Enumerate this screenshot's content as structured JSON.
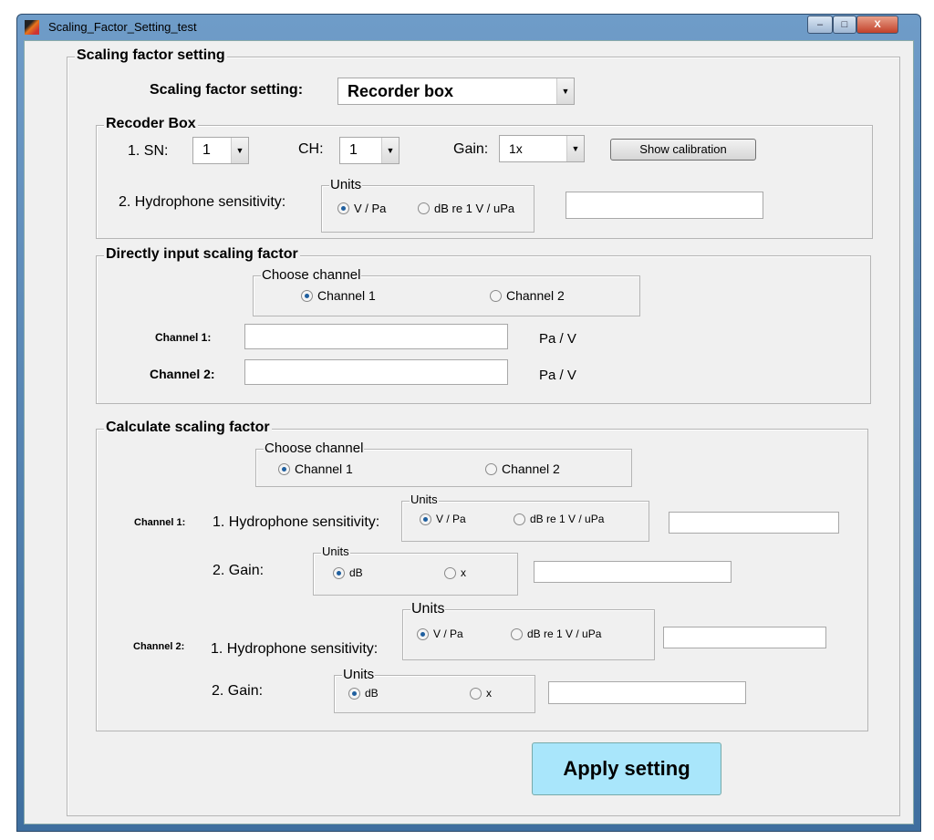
{
  "window": {
    "title": "Scaling_Factor_Setting_test",
    "minimize": "–",
    "maximize": "□",
    "close": "X"
  },
  "main": {
    "legend": "Scaling factor setting",
    "setting_label": "Scaling factor setting:",
    "setting_value": "Recorder box"
  },
  "recorder": {
    "legend": "Recoder Box",
    "sn_label": "1.  SN:",
    "sn_value": "1",
    "ch_label": "CH:",
    "ch_value": "1",
    "gain_label": "Gain:",
    "gain_value": "1x",
    "show_calibration": "Show calibration",
    "hydro_label": "2.  Hydrophone sensitivity:",
    "units": "Units",
    "opt1": "V / Pa",
    "opt2": "dB re 1 V / uPa",
    "value": ""
  },
  "direct": {
    "legend": "Directly input scaling factor",
    "choose": "Choose channel",
    "ch1": "Channel 1",
    "ch2": "Channel 2",
    "ch1_label": "Channel 1:",
    "ch2_label": "Channel 2:",
    "unit": "Pa / V"
  },
  "calc": {
    "legend": "Calculate scaling factor",
    "choose": "Choose channel",
    "ch1": "Channel 1",
    "ch2": "Channel 2",
    "ch1_label": "Channel 1:",
    "ch2_label": "Channel 2:",
    "hydro_label": "1.  Hydrophone sensitivity:",
    "gain_label": "2.  Gain:",
    "units": "Units",
    "v_pa": "V / Pa",
    "db": "dB re 1 V / uPa",
    "gain_db": "dB",
    "gain_x": "x"
  },
  "apply": "Apply setting",
  "arrow": "▼"
}
